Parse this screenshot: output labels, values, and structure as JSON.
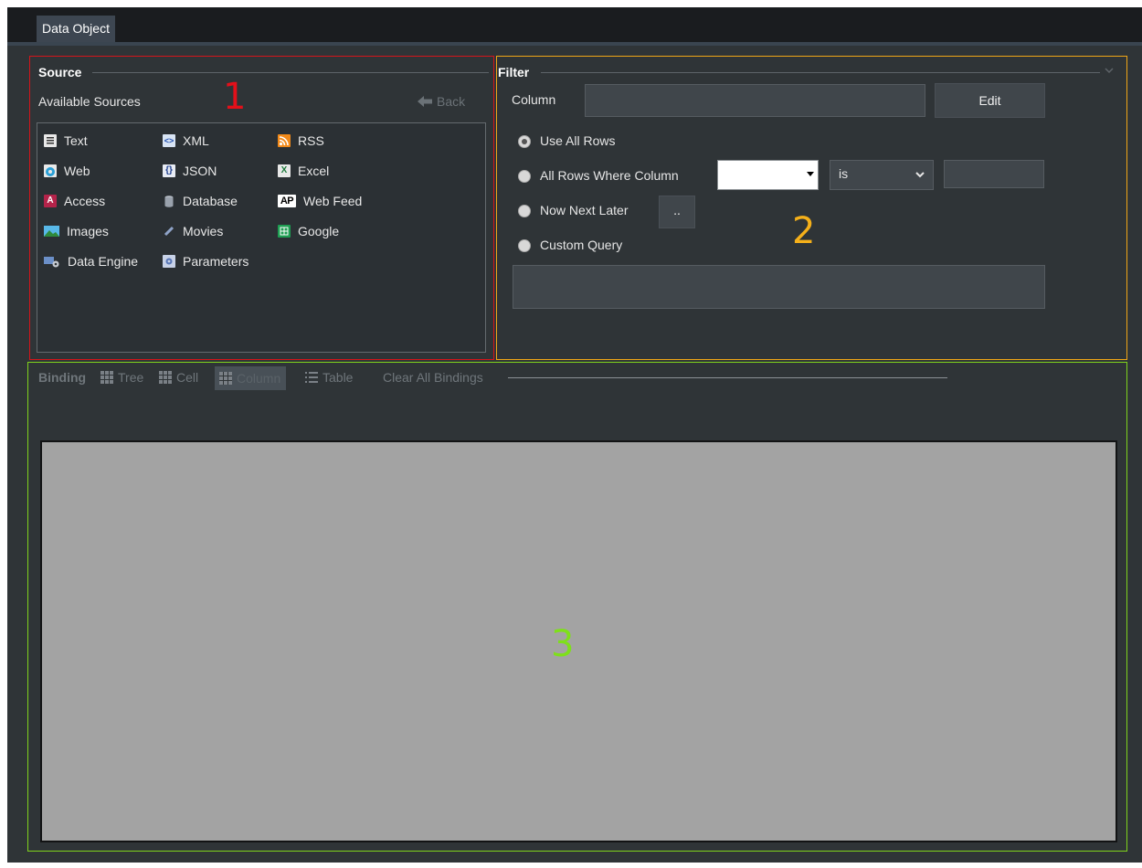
{
  "tab": {
    "label": "Data Object"
  },
  "annotations": {
    "one": "1",
    "two": "2",
    "three": "3",
    "color_one": "#d6141a",
    "color_two": "#f0a616",
    "color_three": "#7fd21c"
  },
  "source": {
    "title": "Source",
    "available_label": "Available Sources",
    "back_label": "Back",
    "items": [
      {
        "label": "Text",
        "icon": "text-file-icon"
      },
      {
        "label": "XML",
        "icon": "xml-icon"
      },
      {
        "label": "RSS",
        "icon": "rss-icon"
      },
      {
        "label": "Web",
        "icon": "web-icon"
      },
      {
        "label": "JSON",
        "icon": "json-icon"
      },
      {
        "label": "Excel",
        "icon": "excel-icon"
      },
      {
        "label": "Access",
        "icon": "access-icon"
      },
      {
        "label": "Database",
        "icon": "database-icon"
      },
      {
        "label": "Web Feed",
        "icon": "ap-feed-icon"
      },
      {
        "label": "Images",
        "icon": "images-icon"
      },
      {
        "label": "Movies",
        "icon": "movies-icon"
      },
      {
        "label": "Google",
        "icon": "google-sheets-icon"
      },
      {
        "label": "Data Engine",
        "icon": "data-engine-icon"
      },
      {
        "label": "Parameters",
        "icon": "parameters-icon"
      }
    ]
  },
  "filter": {
    "title": "Filter",
    "column_label": "Column",
    "column_value": "",
    "edit_label": "Edit",
    "options": {
      "use_all_rows": "Use All Rows",
      "all_rows_where": "All Rows Where Column",
      "now_next_later": "Now Next Later",
      "custom_query": "Custom Query"
    },
    "selected_option": "use_all_rows",
    "column_select_value": "",
    "operator_value": "is",
    "match_value": "",
    "nnl_button": "..",
    "custom_query_value": ""
  },
  "binding": {
    "title": "Binding",
    "tree": "Tree",
    "cell": "Cell",
    "column": "Column",
    "table": "Table",
    "clear_all": "Clear All Bindings"
  }
}
